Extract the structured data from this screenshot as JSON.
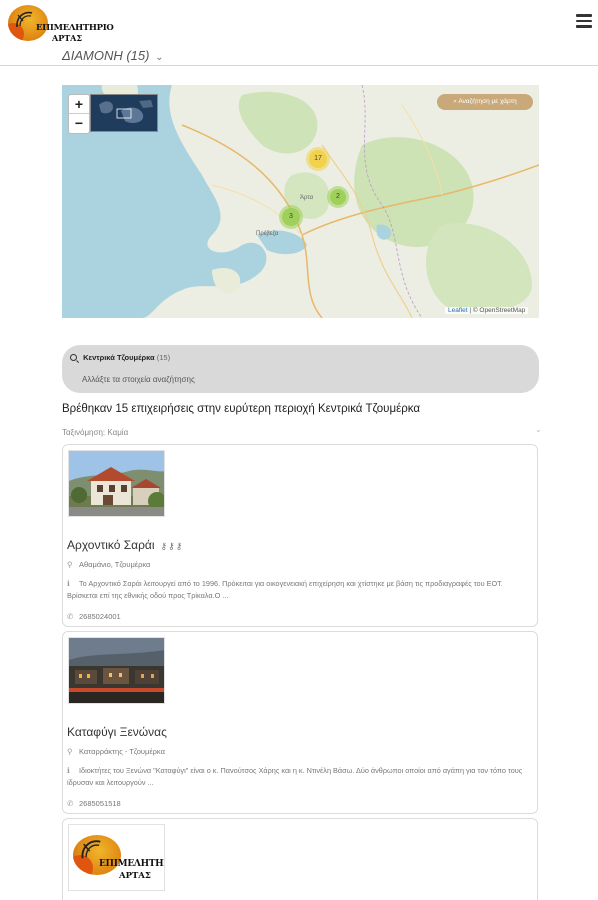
{
  "header": {
    "logo_line1": "ΕΠΙΜΕΛΗΤΗΡΙΟ",
    "logo_line2": "ΑΡΤΑΣ",
    "category_label": "ΔΙΑΜΟΝΗ (15)"
  },
  "map": {
    "zoom_in": "+",
    "zoom_out": "−",
    "search_area_button": "Αναζήτηση με χάρτη",
    "clusters": [
      "17",
      "2",
      "3"
    ],
    "place_labels": [
      "Άρτα",
      "Πρέβεζα"
    ],
    "attribution_leaflet": "Leaflet",
    "attribution_osm": "| © OpenStreetMap"
  },
  "search": {
    "location": "Κεντρικά Τζουμέρκα",
    "count": "(15)",
    "change_text": "Αλλάξτε τα στοιχεία αναζήτησης"
  },
  "results_title": "Βρέθηκαν 15 επιχειρήσεις στην ευρύτερη περιοχή Κεντρικά Τζουμέρκα",
  "sort_label": "Ταξινόμηση: Καμία",
  "listings": [
    {
      "name": "Αρχοντικό Σαράι",
      "keys": "⚷⚷⚷",
      "location": "Αθαμάνιο, Τζουμέρκα",
      "description": "Το Αρχοντικό Σαράι λειτουργεί από το 1996. Πρόκειται για οικογενειακή επιχείρηση και χτίστηκε με βάση τις προδιαγραφές του ΕΟΤ. Βρίσκεται επί της εθνικής οδού προς Τρίκαλα.Ο ...",
      "phone": "2685024001"
    },
    {
      "name": "Καταφύγι Ξενώνας",
      "location": "Καταρράκτης - Τζουμέρκα",
      "description": "Ιδιοκτήτες του Ξενώνα \"Καταφύγι\" είναι ο κ. Πανούτσος Χάρης και η κ. Ντινέλη Βάσω. Δύο άνθρωποι οποίοι από αγάπη για τον τόπο τους ίδρυσαν και λειτουργούν ...",
      "phone": "2685051518"
    },
    {
      "logo_line1": "ΕΠΙΜΕΛΗΤΗΡΙΟ",
      "logo_line2": "ΑΡΤΑΣ"
    }
  ],
  "colors": {
    "accent": "#c9a87a",
    "cluster_yellow": "#f1d24a",
    "cluster_green": "#9ed05a",
    "search_bg": "#d9d9d9"
  }
}
